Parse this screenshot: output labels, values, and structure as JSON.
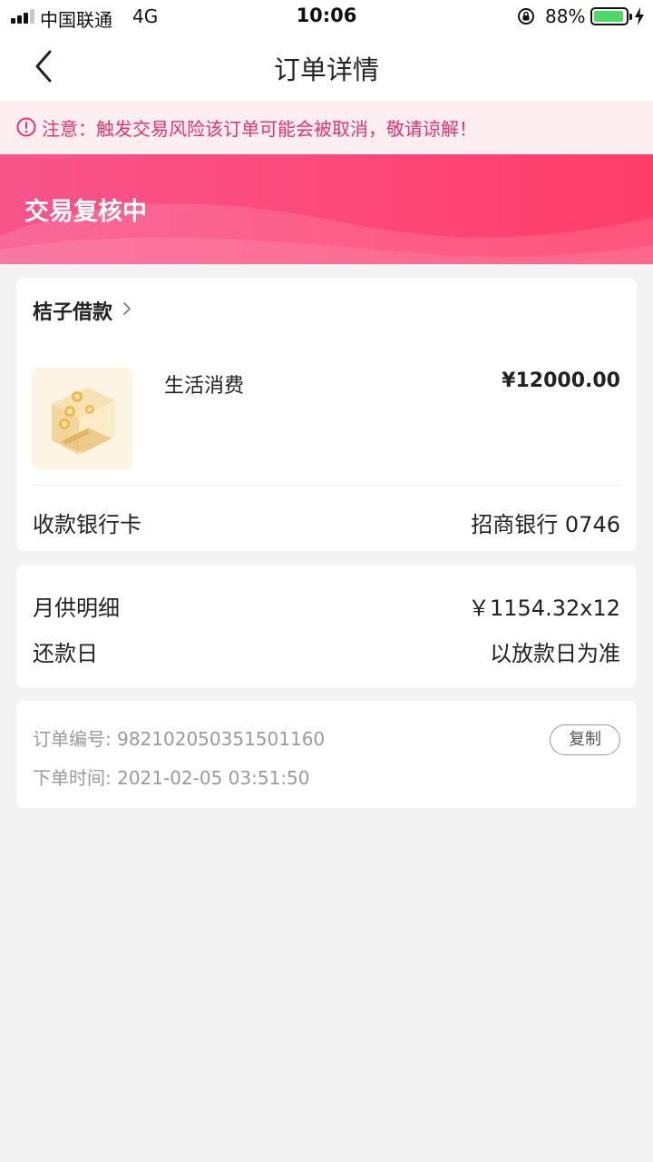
{
  "status_bar": {
    "carrier": "中国联通",
    "network": "4G",
    "time": "10:06",
    "battery_percent": "88%",
    "battery_level": 0.88,
    "battery_color": "#4cd964"
  },
  "nav": {
    "back_icon": "chevron-left-icon",
    "title": "订单详情"
  },
  "warning": {
    "icon": "alert-circle-icon",
    "text": "注意：触发交易风险该订单可能会被取消，敬请谅解！",
    "color": "#e8336b",
    "background": "#fdeef2"
  },
  "status": {
    "title": "交易复核中",
    "gradient": [
      "#f8548b",
      "#ff3e6a"
    ]
  },
  "order": {
    "merchant": "桔子借款",
    "product_name": "生活消费",
    "price": "¥12000.00",
    "bank_label": "收款银行卡",
    "bank_value": "招商银行 0746"
  },
  "repayment": {
    "monthly_label": "月供明细",
    "monthly_value": "￥1154.32x12",
    "due_label": "还款日",
    "due_value": "以放款日为准"
  },
  "meta": {
    "order_no": "订单编号: 982102050351501160",
    "order_time": "下单时间: 2021-02-05 03:51:50",
    "copy_label": "复制"
  }
}
